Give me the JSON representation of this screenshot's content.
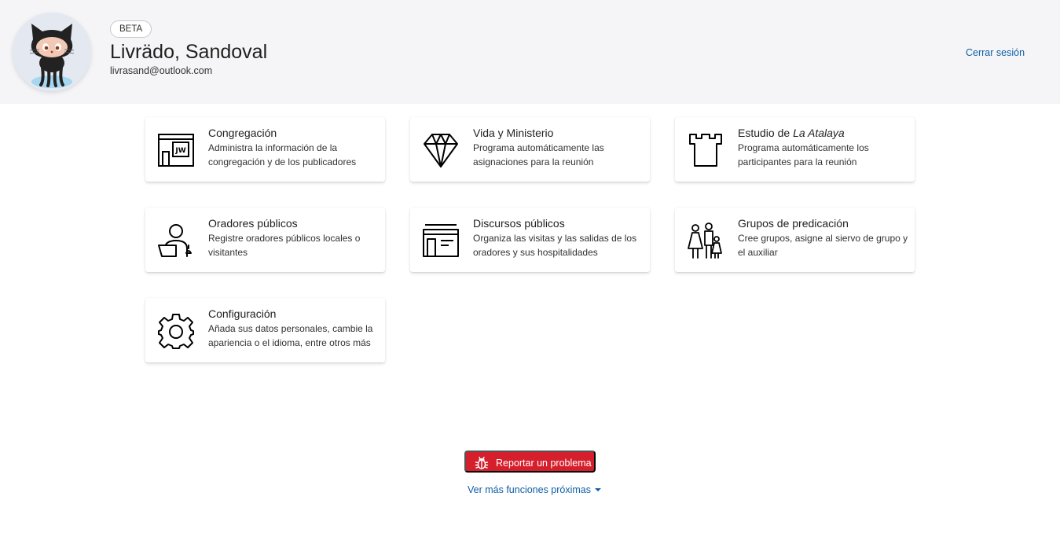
{
  "header": {
    "badge": "BETA",
    "user_name": "Livrädo, Sandoval",
    "email": "livrasand@outlook.com",
    "logout": "Cerrar sesión",
    "avatar_icon": "octocat-icon"
  },
  "cards": [
    {
      "title": "Congregación",
      "description": "Administra la información de la congregación y de los publicadores",
      "icon": "building-jw-icon"
    },
    {
      "title": "Vida y Ministerio",
      "description": "Programa automáticamente las asignaciones para la reunión",
      "icon": "diamond-icon"
    },
    {
      "title_prefix": "Estudio de ",
      "title_italic": "La Atalaya",
      "description": "Programa automáticamente los participantes para la reunión",
      "icon": "watchtower-icon"
    },
    {
      "title": "Oradores públicos",
      "description": "Registre oradores públicos locales o visitantes",
      "icon": "speaker-icon"
    },
    {
      "title": "Discursos públicos",
      "description": "Organiza las visitas y las salidas de los oradores y sus hospitalidades",
      "icon": "talks-board-icon"
    },
    {
      "title": "Grupos de predicación",
      "description": "Cree grupos, asigne al siervo de grupo y el auxiliar",
      "icon": "family-group-icon"
    },
    {
      "title": "Configuración",
      "description": "Añada sus datos personales, cambie la apariencia o el idioma, entre otros más",
      "icon": "gear-icon"
    }
  ],
  "footer": {
    "report_button": "Reportar un problema",
    "report_icon": "bug-icon",
    "more_link": "Ver más funciones próximas",
    "more_icon": "caret-down-icon"
  },
  "colors": {
    "header_bg": "#f5f5f7",
    "link": "#0f5ea6",
    "report_button_bg": "#d61f2c",
    "text": "#201f1e"
  }
}
